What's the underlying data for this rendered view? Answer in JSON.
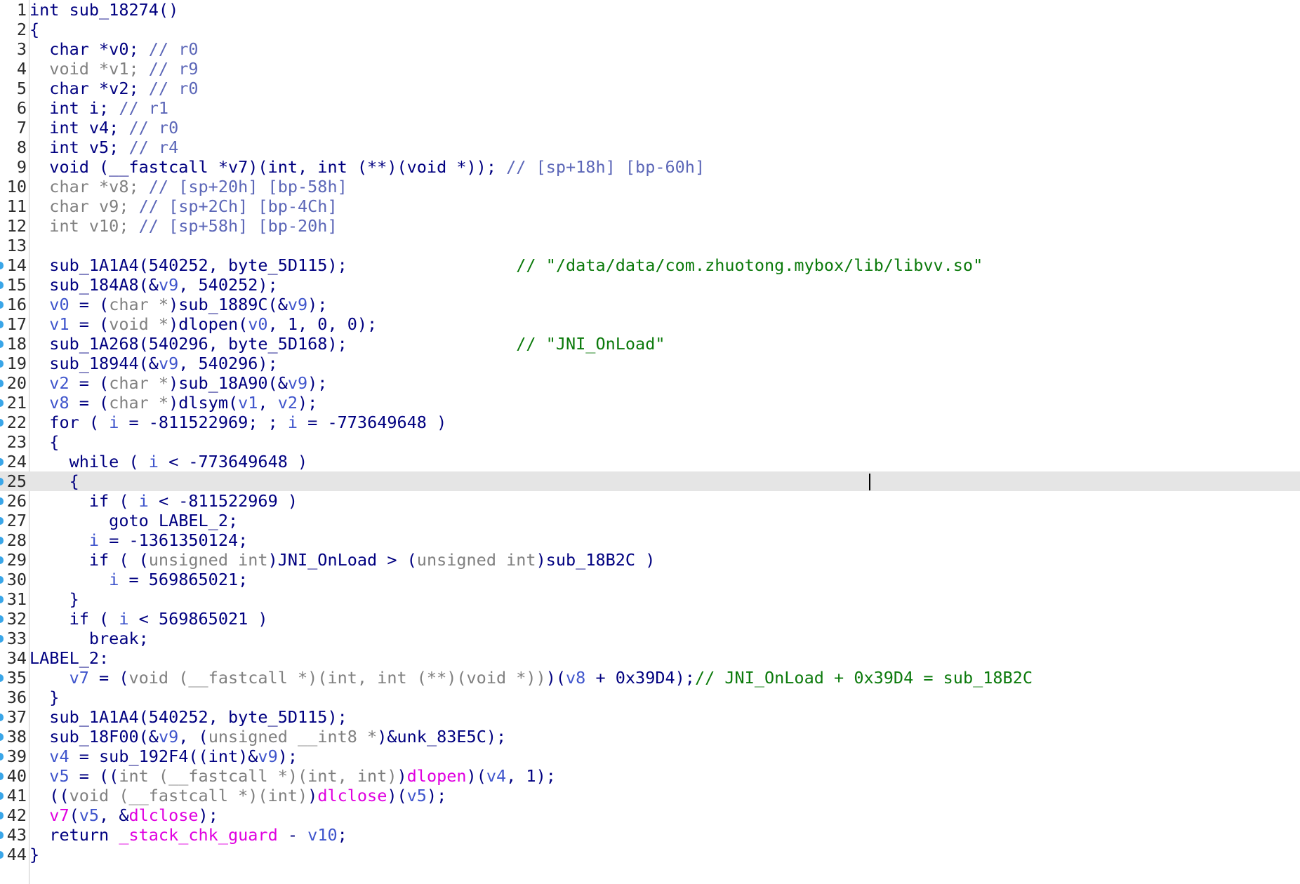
{
  "editor": {
    "current_line": 25,
    "lines": [
      {
        "n": "1",
        "bp": false,
        "tokens": [
          {
            "t": "int sub_18274()",
            "c": "kw"
          }
        ]
      },
      {
        "n": "2",
        "bp": false,
        "tokens": [
          {
            "t": "{",
            "c": "kw"
          }
        ]
      },
      {
        "n": "3",
        "bp": false,
        "tokens": [
          {
            "t": "  char *v0; ",
            "c": "kw"
          },
          {
            "t": "// r0",
            "c": "cmt"
          }
        ]
      },
      {
        "n": "4",
        "bp": false,
        "tokens": [
          {
            "t": "  void *v1; ",
            "c": "gray"
          },
          {
            "t": "// r9",
            "c": "cmt"
          }
        ]
      },
      {
        "n": "5",
        "bp": false,
        "tokens": [
          {
            "t": "  char *v2; ",
            "c": "kw"
          },
          {
            "t": "// r0",
            "c": "cmt"
          }
        ]
      },
      {
        "n": "6",
        "bp": false,
        "tokens": [
          {
            "t": "  int i; ",
            "c": "kw"
          },
          {
            "t": "// r1",
            "c": "cmt"
          }
        ]
      },
      {
        "n": "7",
        "bp": false,
        "tokens": [
          {
            "t": "  int v4; ",
            "c": "kw"
          },
          {
            "t": "// r0",
            "c": "cmt"
          }
        ]
      },
      {
        "n": "8",
        "bp": false,
        "tokens": [
          {
            "t": "  int v5; ",
            "c": "kw"
          },
          {
            "t": "// r4",
            "c": "cmt"
          }
        ]
      },
      {
        "n": "9",
        "bp": false,
        "tokens": [
          {
            "t": "  void (__fastcall *v7)(int, int (**)(void *)); ",
            "c": "kw"
          },
          {
            "t": "// [sp+18h] [bp-60h]",
            "c": "cmt"
          }
        ]
      },
      {
        "n": "10",
        "bp": false,
        "tokens": [
          {
            "t": "  char *v8; ",
            "c": "gray"
          },
          {
            "t": "// [sp+20h] [bp-58h]",
            "c": "cmt"
          }
        ]
      },
      {
        "n": "11",
        "bp": false,
        "tokens": [
          {
            "t": "  char v9; ",
            "c": "gray"
          },
          {
            "t": "// [sp+2Ch] [bp-4Ch]",
            "c": "cmt"
          }
        ]
      },
      {
        "n": "12",
        "bp": false,
        "tokens": [
          {
            "t": "  int v10; ",
            "c": "gray"
          },
          {
            "t": "// [sp+58h] [bp-20h]",
            "c": "cmt"
          }
        ]
      },
      {
        "n": "13",
        "bp": false,
        "tokens": [
          {
            "t": "",
            "c": "kw"
          }
        ]
      },
      {
        "n": "14",
        "bp": true,
        "tokens": [
          {
            "t": "  sub_1A1A4(540252, byte_5D115);                 ",
            "c": "kw"
          },
          {
            "t": "// \"/data/data/com.zhuotong.mybox/lib/libvv.so\"",
            "c": "str"
          }
        ]
      },
      {
        "n": "15",
        "bp": true,
        "tokens": [
          {
            "t": "  sub_184A8(&",
            "c": "kw"
          },
          {
            "t": "v9",
            "c": "var"
          },
          {
            "t": ", 540252);",
            "c": "kw"
          }
        ]
      },
      {
        "n": "16",
        "bp": true,
        "tokens": [
          {
            "t": "  ",
            "c": "kw"
          },
          {
            "t": "v0",
            "c": "var"
          },
          {
            "t": " = (",
            "c": "kw"
          },
          {
            "t": "char *",
            "c": "gray"
          },
          {
            "t": ")sub_1889C(&",
            "c": "kw"
          },
          {
            "t": "v9",
            "c": "var"
          },
          {
            "t": ");",
            "c": "kw"
          }
        ]
      },
      {
        "n": "17",
        "bp": true,
        "tokens": [
          {
            "t": "  ",
            "c": "kw"
          },
          {
            "t": "v1",
            "c": "var"
          },
          {
            "t": " = (",
            "c": "kw"
          },
          {
            "t": "void *",
            "c": "gray"
          },
          {
            "t": ")dlopen(",
            "c": "kw"
          },
          {
            "t": "v0",
            "c": "var"
          },
          {
            "t": ", 1, 0, 0);",
            "c": "kw"
          }
        ]
      },
      {
        "n": "18",
        "bp": true,
        "tokens": [
          {
            "t": "  sub_1A268(540296, byte_5D168);                 ",
            "c": "kw"
          },
          {
            "t": "// \"JNI_OnLoad\"",
            "c": "str"
          }
        ]
      },
      {
        "n": "19",
        "bp": true,
        "tokens": [
          {
            "t": "  sub_18944(&",
            "c": "kw"
          },
          {
            "t": "v9",
            "c": "var"
          },
          {
            "t": ", 540296);",
            "c": "kw"
          }
        ]
      },
      {
        "n": "20",
        "bp": true,
        "tokens": [
          {
            "t": "  ",
            "c": "kw"
          },
          {
            "t": "v2",
            "c": "var"
          },
          {
            "t": " = (",
            "c": "kw"
          },
          {
            "t": "char *",
            "c": "gray"
          },
          {
            "t": ")sub_18A90(&",
            "c": "kw"
          },
          {
            "t": "v9",
            "c": "var"
          },
          {
            "t": ");",
            "c": "kw"
          }
        ]
      },
      {
        "n": "21",
        "bp": true,
        "tokens": [
          {
            "t": "  ",
            "c": "kw"
          },
          {
            "t": "v8",
            "c": "var"
          },
          {
            "t": " = (",
            "c": "kw"
          },
          {
            "t": "char *",
            "c": "gray"
          },
          {
            "t": ")dlsym(",
            "c": "kw"
          },
          {
            "t": "v1",
            "c": "var"
          },
          {
            "t": ", ",
            "c": "kw"
          },
          {
            "t": "v2",
            "c": "var"
          },
          {
            "t": ");",
            "c": "kw"
          }
        ]
      },
      {
        "n": "22",
        "bp": true,
        "tokens": [
          {
            "t": "  for ( ",
            "c": "kw"
          },
          {
            "t": "i",
            "c": "var"
          },
          {
            "t": " = -811522969; ; ",
            "c": "kw"
          },
          {
            "t": "i",
            "c": "var"
          },
          {
            "t": " = -773649648 )",
            "c": "kw"
          }
        ]
      },
      {
        "n": "23",
        "bp": false,
        "tokens": [
          {
            "t": "  {",
            "c": "kw"
          }
        ]
      },
      {
        "n": "24",
        "bp": true,
        "tokens": [
          {
            "t": "    while ( ",
            "c": "kw"
          },
          {
            "t": "i",
            "c": "var"
          },
          {
            "t": " < -773649648 )",
            "c": "kw"
          }
        ]
      },
      {
        "n": "25",
        "bp": true,
        "tokens": [
          {
            "t": "    {",
            "c": "kw"
          }
        ]
      },
      {
        "n": "26",
        "bp": true,
        "tokens": [
          {
            "t": "      if ( ",
            "c": "kw"
          },
          {
            "t": "i",
            "c": "var"
          },
          {
            "t": " < -811522969 )",
            "c": "kw"
          }
        ]
      },
      {
        "n": "27",
        "bp": true,
        "tokens": [
          {
            "t": "        goto LABEL_2;",
            "c": "kw"
          }
        ]
      },
      {
        "n": "28",
        "bp": true,
        "tokens": [
          {
            "t": "      ",
            "c": "kw"
          },
          {
            "t": "i",
            "c": "var"
          },
          {
            "t": " = -1361350124;",
            "c": "kw"
          }
        ]
      },
      {
        "n": "29",
        "bp": true,
        "tokens": [
          {
            "t": "      if ( (",
            "c": "kw"
          },
          {
            "t": "unsigned int",
            "c": "gray"
          },
          {
            "t": ")JNI_OnLoad > (",
            "c": "kw"
          },
          {
            "t": "unsigned int",
            "c": "gray"
          },
          {
            "t": ")sub_18B2C )",
            "c": "kw"
          }
        ]
      },
      {
        "n": "30",
        "bp": true,
        "tokens": [
          {
            "t": "        ",
            "c": "kw"
          },
          {
            "t": "i",
            "c": "var"
          },
          {
            "t": " = 569865021;",
            "c": "kw"
          }
        ]
      },
      {
        "n": "31",
        "bp": true,
        "tokens": [
          {
            "t": "    }",
            "c": "kw"
          }
        ]
      },
      {
        "n": "32",
        "bp": true,
        "tokens": [
          {
            "t": "    if ( ",
            "c": "kw"
          },
          {
            "t": "i",
            "c": "var"
          },
          {
            "t": " < 569865021 )",
            "c": "kw"
          }
        ]
      },
      {
        "n": "33",
        "bp": true,
        "tokens": [
          {
            "t": "      break;",
            "c": "kw"
          }
        ]
      },
      {
        "n": "34",
        "bp": false,
        "tokens": [
          {
            "t": "LABEL_2:",
            "c": "kw"
          }
        ]
      },
      {
        "n": "35",
        "bp": true,
        "tokens": [
          {
            "t": "    ",
            "c": "kw"
          },
          {
            "t": "v7",
            "c": "var"
          },
          {
            "t": " = (",
            "c": "kw"
          },
          {
            "t": "void (__fastcall *)(int, int (**)(void *))",
            "c": "gray"
          },
          {
            "t": ")(",
            "c": "kw"
          },
          {
            "t": "v8",
            "c": "var"
          },
          {
            "t": " + 0x39D4);",
            "c": "kw"
          },
          {
            "t": "// JNI_OnLoad + 0x39D4 = sub_18B2C",
            "c": "str"
          }
        ]
      },
      {
        "n": "36",
        "bp": false,
        "tokens": [
          {
            "t": "  }",
            "c": "kw"
          }
        ]
      },
      {
        "n": "37",
        "bp": true,
        "tokens": [
          {
            "t": "  sub_1A1A4(540252, byte_5D115);",
            "c": "kw"
          }
        ]
      },
      {
        "n": "38",
        "bp": true,
        "tokens": [
          {
            "t": "  sub_18F00(&",
            "c": "kw"
          },
          {
            "t": "v9",
            "c": "var"
          },
          {
            "t": ", (",
            "c": "kw"
          },
          {
            "t": "unsigned __int8 *",
            "c": "gray"
          },
          {
            "t": ")&unk_83E5C);",
            "c": "kw"
          }
        ]
      },
      {
        "n": "39",
        "bp": true,
        "tokens": [
          {
            "t": "  ",
            "c": "kw"
          },
          {
            "t": "v4",
            "c": "var"
          },
          {
            "t": " = sub_192F4((int)&",
            "c": "kw"
          },
          {
            "t": "v9",
            "c": "var"
          },
          {
            "t": ");",
            "c": "kw"
          }
        ]
      },
      {
        "n": "40",
        "bp": true,
        "tokens": [
          {
            "t": "  ",
            "c": "kw"
          },
          {
            "t": "v5",
            "c": "var"
          },
          {
            "t": " = ((",
            "c": "kw"
          },
          {
            "t": "int (__fastcall *)(int, int)",
            "c": "gray"
          },
          {
            "t": ")",
            "c": "kw"
          },
          {
            "t": "dlopen",
            "c": "imp"
          },
          {
            "t": ")(",
            "c": "kw"
          },
          {
            "t": "v4",
            "c": "var"
          },
          {
            "t": ", 1);",
            "c": "kw"
          }
        ]
      },
      {
        "n": "41",
        "bp": true,
        "tokens": [
          {
            "t": "  ((",
            "c": "kw"
          },
          {
            "t": "void (__fastcall *)(int)",
            "c": "gray"
          },
          {
            "t": ")",
            "c": "kw"
          },
          {
            "t": "dlclose",
            "c": "imp"
          },
          {
            "t": ")(",
            "c": "kw"
          },
          {
            "t": "v5",
            "c": "var"
          },
          {
            "t": ");",
            "c": "kw"
          }
        ]
      },
      {
        "n": "42",
        "bp": true,
        "tokens": [
          {
            "t": "  ",
            "c": "kw"
          },
          {
            "t": "v7",
            "c": "imp"
          },
          {
            "t": "(",
            "c": "kw"
          },
          {
            "t": "v5",
            "c": "var"
          },
          {
            "t": ", &",
            "c": "kw"
          },
          {
            "t": "dlclose",
            "c": "imp"
          },
          {
            "t": ");",
            "c": "kw"
          }
        ]
      },
      {
        "n": "43",
        "bp": true,
        "tokens": [
          {
            "t": "  return ",
            "c": "kw"
          },
          {
            "t": "_stack_chk_guard",
            "c": "imp"
          },
          {
            "t": " - ",
            "c": "kw"
          },
          {
            "t": "v10",
            "c": "var"
          },
          {
            "t": ";",
            "c": "kw"
          }
        ]
      },
      {
        "n": "44",
        "bp": true,
        "tokens": [
          {
            "t": "}",
            "c": "kw"
          }
        ]
      }
    ]
  }
}
